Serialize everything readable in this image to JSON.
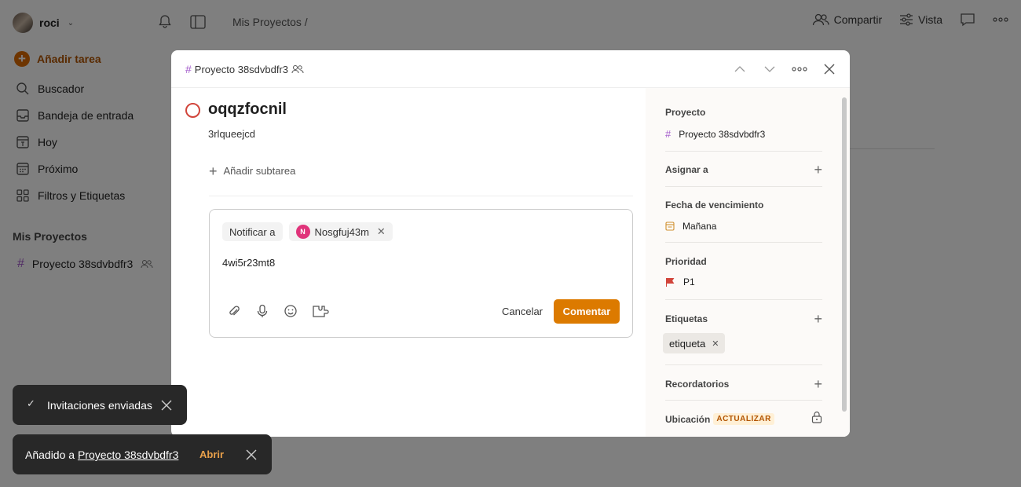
{
  "user": {
    "name": "roci"
  },
  "breadcrumb": "Mis Proyectos /",
  "top_actions": {
    "share": "Compartir",
    "view": "Vista"
  },
  "sidebar": {
    "add_task": "Añadir tarea",
    "items": [
      {
        "label": "Buscador",
        "icon": "search-icon"
      },
      {
        "label": "Bandeja de entrada",
        "icon": "inbox-icon"
      },
      {
        "label": "Hoy",
        "icon": "calendar-today-icon"
      },
      {
        "label": "Próximo",
        "icon": "calendar-upcoming-icon"
      },
      {
        "label": "Filtros y Etiquetas",
        "icon": "filters-icon"
      }
    ],
    "section_title": "Mis Proyectos",
    "project": "Proyecto 38sdvbdfr3"
  },
  "modal": {
    "project": "Proyecto 38sdvbdfr3",
    "task": {
      "title": "oqqzfocnil",
      "description": "3rlqueejcd",
      "add_subtask": "Añadir subtarea"
    },
    "comment": {
      "notify_label": "Notificar a",
      "mention": {
        "initial": "N",
        "name": "Nosgfuj43m"
      },
      "text": "4wi5r23mt8",
      "cancel": "Cancelar",
      "submit": "Comentar"
    },
    "side": {
      "project_label": "Proyecto",
      "project_value": "Proyecto 38sdvbdfr3",
      "assign_label": "Asignar a",
      "due_label": "Fecha de vencimiento",
      "due_value": "Mañana",
      "priority_label": "Prioridad",
      "priority_value": "P1",
      "labels_label": "Etiquetas",
      "label_chip": "etiqueta",
      "reminders_label": "Recordatorios",
      "location_label": "Ubicación",
      "location_badge": "ACTUALIZAR"
    }
  },
  "toasts": {
    "invites": "Invitaciones enviadas",
    "added_prefix": "Añadido a",
    "added_project": "Proyecto 38sdvbdfr3",
    "open": "Abrir"
  },
  "colors": {
    "accent": "#dc7a00",
    "priority_red": "#d1453b",
    "project_hash": "#a35acb"
  }
}
